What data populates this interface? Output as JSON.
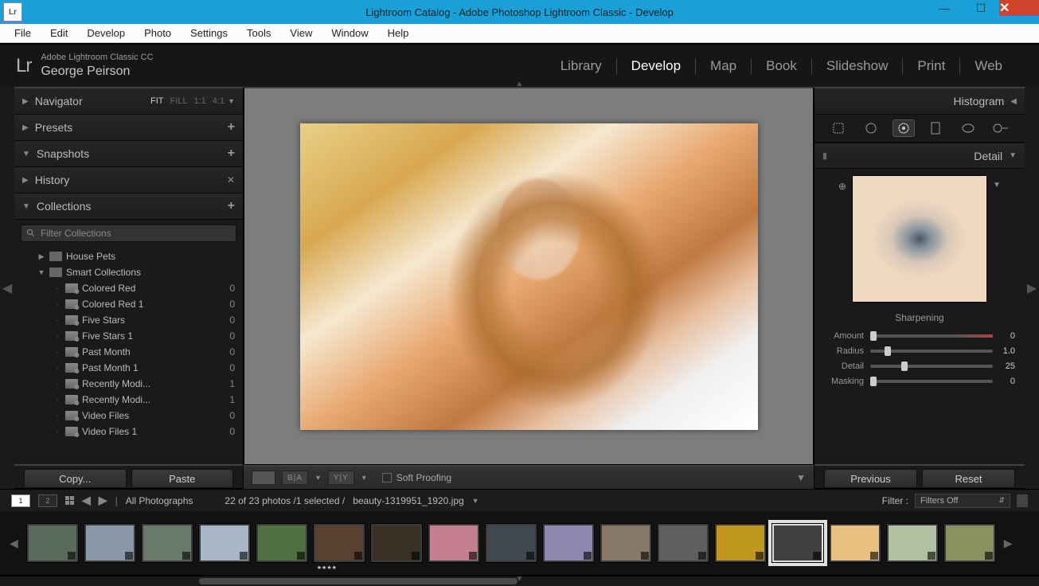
{
  "window": {
    "title": "Lightroom Catalog - Adobe Photoshop Lightroom Classic - Develop",
    "app_icon": "Lr"
  },
  "menubar": [
    "File",
    "Edit",
    "Develop",
    "Photo",
    "Settings",
    "Tools",
    "View",
    "Window",
    "Help"
  ],
  "identity": {
    "logo": "Lr",
    "product": "Adobe Lightroom Classic CC",
    "user": "George Peirson"
  },
  "modules": [
    "Library",
    "Develop",
    "Map",
    "Book",
    "Slideshow",
    "Print",
    "Web"
  ],
  "active_module": "Develop",
  "left": {
    "navigator": {
      "label": "Navigator",
      "opts": [
        "FIT",
        "FILL",
        "1:1",
        "4:1"
      ],
      "active_opt": "FIT"
    },
    "presets": {
      "label": "Presets"
    },
    "snapshots": {
      "label": "Snapshots"
    },
    "history": {
      "label": "History"
    },
    "collections": {
      "label": "Collections"
    },
    "filter_placeholder": "Filter Collections",
    "tree": [
      {
        "level": 0,
        "expanded": false,
        "icon": "set",
        "name": "House Pets",
        "count": ""
      },
      {
        "level": 0,
        "expanded": true,
        "icon": "set",
        "name": "Smart Collections",
        "count": ""
      },
      {
        "level": 1,
        "icon": "smart",
        "name": "Colored Red",
        "count": "0"
      },
      {
        "level": 1,
        "icon": "smart",
        "name": "Colored Red 1",
        "count": "0"
      },
      {
        "level": 1,
        "icon": "smart",
        "name": "Five Stars",
        "count": "0"
      },
      {
        "level": 1,
        "icon": "smart",
        "name": "Five Stars 1",
        "count": "0"
      },
      {
        "level": 1,
        "icon": "smart",
        "name": "Past Month",
        "count": "0"
      },
      {
        "level": 1,
        "icon": "smart",
        "name": "Past Month 1",
        "count": "0"
      },
      {
        "level": 1,
        "icon": "smart",
        "name": "Recently Modi...",
        "count": "1"
      },
      {
        "level": 1,
        "icon": "smart",
        "name": "Recently Modi...",
        "count": "1"
      },
      {
        "level": 1,
        "icon": "smart",
        "name": "Video Files",
        "count": "0"
      },
      {
        "level": 1,
        "icon": "smart",
        "name": "Video Files 1",
        "count": "0"
      }
    ],
    "copy": "Copy...",
    "paste": "Paste"
  },
  "center": {
    "before_after_a": "B|A",
    "before_after_b": "Y|Y",
    "soft_proof": "Soft Proofing"
  },
  "right": {
    "histogram": "Histogram",
    "detail": "Detail",
    "sharpening": "Sharpening",
    "sliders": [
      {
        "label": "Amount",
        "value": "0",
        "pos": 0,
        "red": true
      },
      {
        "label": "Radius",
        "value": "1.0",
        "pos": 12
      },
      {
        "label": "Detail",
        "value": "25",
        "pos": 25
      },
      {
        "label": "Masking",
        "value": "0",
        "pos": 0
      }
    ],
    "previous": "Previous",
    "reset": "Reset"
  },
  "infobar": {
    "primary": "1",
    "secondary": "2",
    "source": "All Photographs",
    "status": "22 of 23 photos /1 selected /",
    "filename": "beauty-1319951_1920.jpg",
    "filter_label": "Filter :",
    "filter_value": "Filters Off"
  },
  "filmstrip": {
    "thumbs": 17,
    "selected_index": 13,
    "starred_index": 5
  }
}
